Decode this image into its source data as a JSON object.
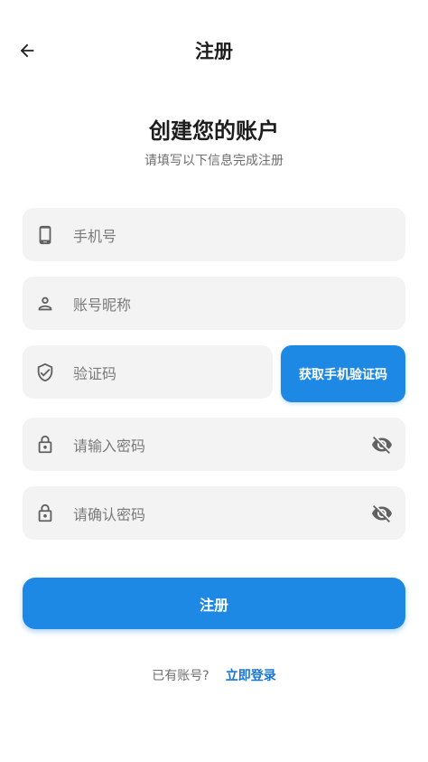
{
  "appbar": {
    "title": "注册",
    "back_icon": "arrow-left-icon"
  },
  "header": {
    "headline": "创建您的账户",
    "subline": "请填写以下信息完成注册"
  },
  "form": {
    "phone": {
      "placeholder": "手机号",
      "icon": "smartphone-icon"
    },
    "nickname": {
      "placeholder": "账号昵称",
      "icon": "person-icon"
    },
    "code": {
      "placeholder": "验证码",
      "icon": "shield-check-icon",
      "button_label": "获取手机验证码"
    },
    "password": {
      "placeholder": "请输入密码",
      "icon": "lock-icon",
      "toggle_icon": "eye-off-icon"
    },
    "confirm_password": {
      "placeholder": "请确认密码",
      "icon": "lock-icon",
      "toggle_icon": "eye-off-icon"
    },
    "submit_label": "注册"
  },
  "footer": {
    "question": "已有账号?",
    "login_link": "立即登录"
  },
  "colors": {
    "accent": "#1e88e5",
    "field_bg": "#f3f3f3",
    "link": "#1976d2"
  }
}
